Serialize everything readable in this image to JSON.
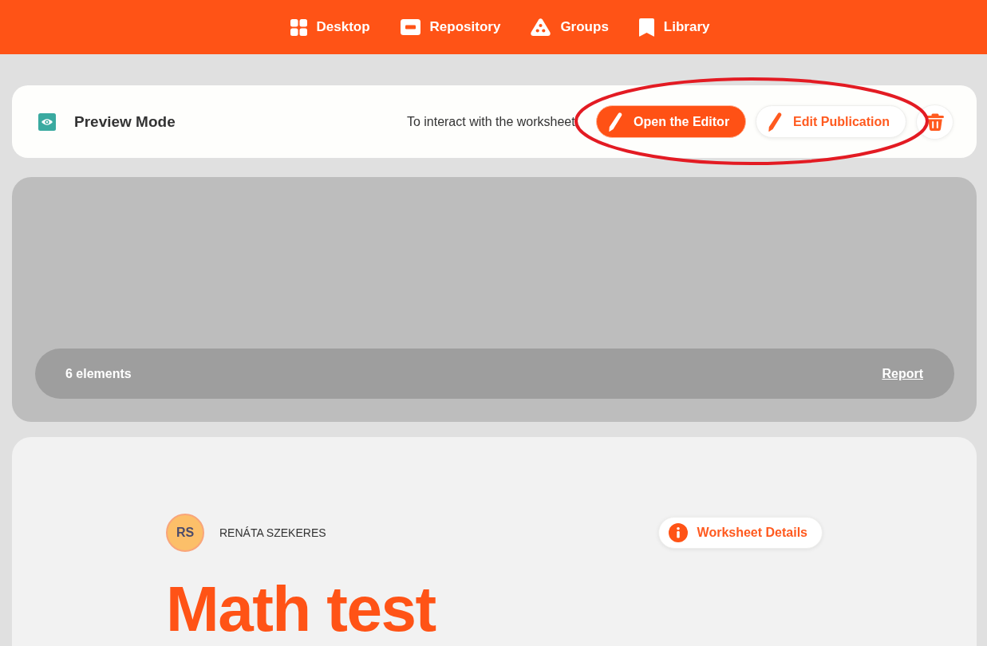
{
  "nav": {
    "items": [
      {
        "label": "Desktop",
        "kind": "grid"
      },
      {
        "label": "Repository",
        "kind": "drawer"
      },
      {
        "label": "Groups",
        "kind": "triangle"
      },
      {
        "label": "Library",
        "kind": "bookmark"
      }
    ]
  },
  "toolbar": {
    "mode_label": "Preview Mode",
    "hint": "To interact with the worksheet:",
    "buttons": [
      {
        "label": "Open the Editor",
        "kind": "primary"
      },
      {
        "label": "Edit Publication",
        "kind": "secondary"
      }
    ]
  },
  "preview": {
    "element_count": "6 elements",
    "report_link": "Report"
  },
  "worksheet": {
    "author": {
      "initials": "RS",
      "name": "RENÁTA SZEKERES"
    },
    "details_button": "Worksheet Details",
    "title": "Math test"
  }
}
